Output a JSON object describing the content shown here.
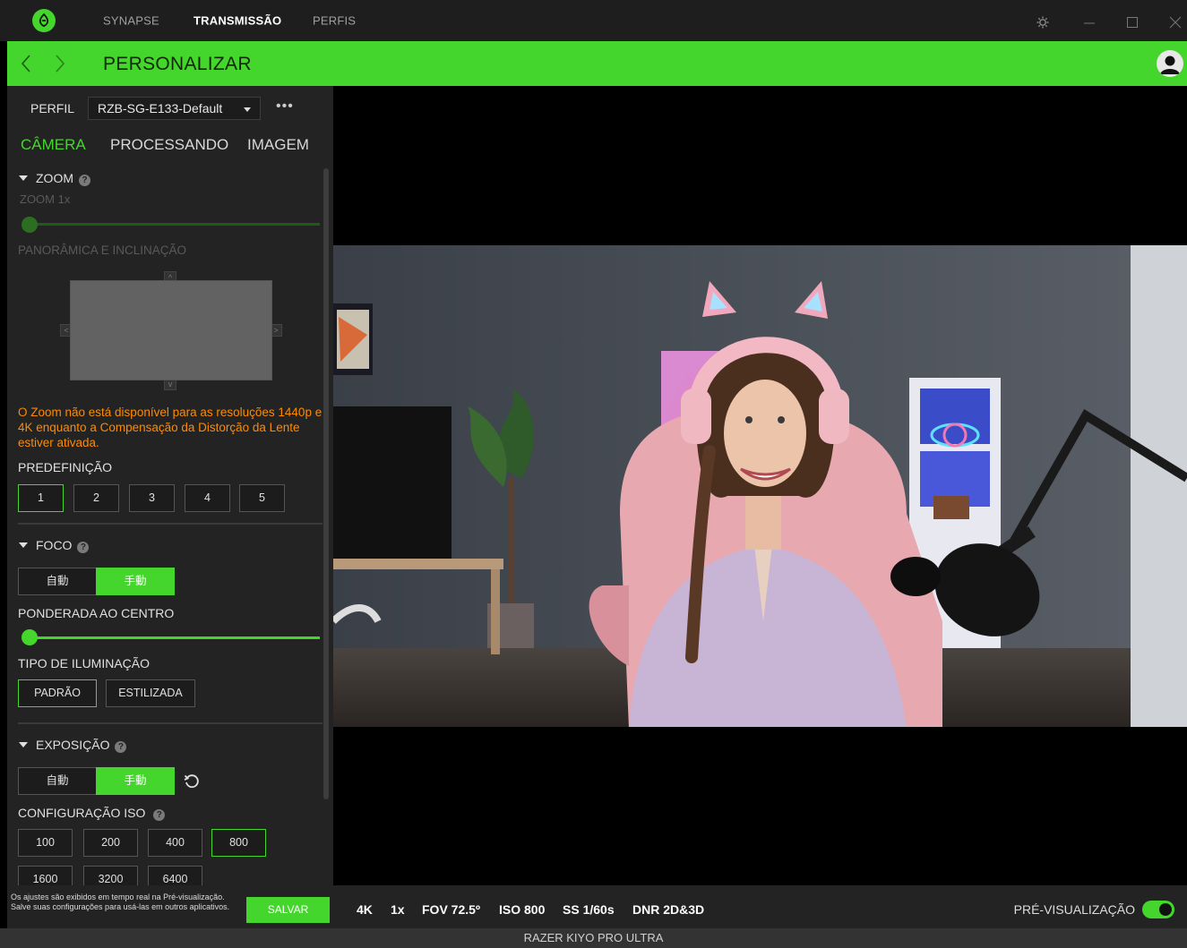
{
  "app": {
    "nav": [
      "SYNAPSE",
      "TRANSMISSÃO",
      "PERFIS"
    ],
    "active_nav": "TRANSMISSÃO"
  },
  "header": {
    "title": "PERSONALIZAR"
  },
  "profile": {
    "label": "PERFIL",
    "value": "RZB-SG-E133-Default",
    "more": "•••"
  },
  "tabs": [
    "CÂMERA",
    "PROCESSANDO",
    "IMAGEM"
  ],
  "zoom": {
    "title": "ZOOM",
    "value_label": "ZOOM  1x",
    "value": 1,
    "pan_tilt_label": "PANORÂMICA E INCLINAÇÃO",
    "warning": "O Zoom não está disponível para as resoluções 1440p e 4K enquanto a Compensação da Distorção da Lente estiver ativada."
  },
  "preset": {
    "label": "PREDEFINIÇÃO",
    "options": [
      "1",
      "2",
      "3",
      "4",
      "5"
    ],
    "selected": "1"
  },
  "focus": {
    "title": "FOCO",
    "auto": "自動",
    "manual": "手動",
    "selected": "manual",
    "weighted_label": "PONDERADA AO CENTRO",
    "slider_value": 0
  },
  "lighting": {
    "label": "TIPO DE ILUMINAÇÃO",
    "options": [
      "PADRÃO",
      "ESTILIZADA"
    ],
    "selected": "PADRÃO"
  },
  "exposure": {
    "title": "EXPOSIÇÃO",
    "auto": "自動",
    "manual": "手動",
    "selected": "manual",
    "iso_label": "CONFIGURAÇÃO ISO",
    "iso_options": [
      "100",
      "200",
      "400",
      "800",
      "1600",
      "3200",
      "6400"
    ],
    "iso_selected": "800"
  },
  "bottom": {
    "note": "Os ajustes são exibidos em tempo real na Pré-visualização. Salve suas configurações para usá-las em outros aplicativos.",
    "save": "SALVAR",
    "stats": [
      "4K",
      "1x",
      "FOV 72.5º",
      "ISO 800",
      "SS 1/60s",
      "DNR 2D&3D"
    ],
    "preview_label": "PRÉ-VISUALIZAÇÃO",
    "preview_on": true
  },
  "device_name": "RAZER KIYO PRO ULTRA",
  "colors": {
    "accent": "#44d62c",
    "warning": "#ff8a00",
    "panel": "#232323"
  },
  "icons": [
    "razer-logo-icon",
    "gear-icon",
    "minimize-icon",
    "maximize-icon",
    "close-icon",
    "back-icon",
    "forward-icon",
    "user-icon",
    "help-icon",
    "reset-icon",
    "chevron-down-icon"
  ]
}
